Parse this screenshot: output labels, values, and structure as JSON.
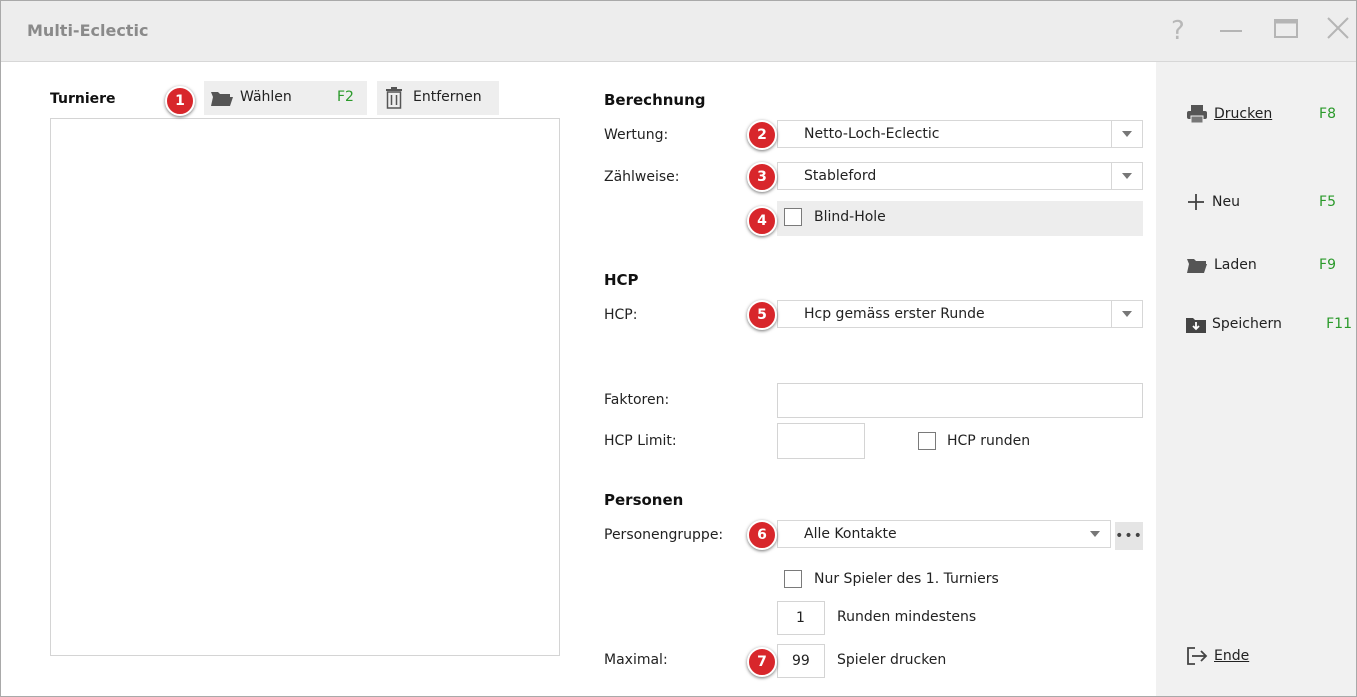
{
  "window": {
    "title": "Multi-Eclectic",
    "controls": [
      "help-icon",
      "minimize-icon",
      "maximize-icon",
      "close-icon"
    ]
  },
  "turniere": {
    "label": "Turniere",
    "waehlen_label": "Wählen",
    "waehlen_key": "F2",
    "entfernen_label": "Entfernen",
    "list_items": []
  },
  "berechnung": {
    "heading": "Berechnung",
    "wertung_label": "Wertung:",
    "wertung_value": "Netto-Loch-Eclectic",
    "zaehlweise_label": "Zählweise:",
    "zaehlweise_value": "Stableford",
    "blind_hole_label": "Blind-Hole",
    "blind_hole_checked": false
  },
  "hcp": {
    "heading": "HCP",
    "hcp_label": "HCP:",
    "hcp_value": "Hcp gemäss erster Runde",
    "faktoren_label": "Faktoren:",
    "faktoren_value": "",
    "limit_label": "HCP Limit:",
    "limit_value": "",
    "runden_label": "HCP runden",
    "runden_checked": false
  },
  "personen": {
    "heading": "Personen",
    "gruppe_label": "Personengruppe:",
    "gruppe_value": "Alle Kontakte",
    "more_label": "•••",
    "nur_spieler_label": "Nur Spieler des 1. Turniers",
    "nur_spieler_checked": false,
    "runden_min_value": "1",
    "runden_min_label": "Runden mindestens",
    "maximal_label": "Maximal:",
    "maximal_value": "99",
    "spieler_drucken_label": "Spieler drucken"
  },
  "sidebar": {
    "items": [
      {
        "label": "Drucken",
        "key": "F8",
        "icon": "printer-icon"
      },
      {
        "label": "Neu",
        "key": "F5",
        "icon": "plus-icon"
      },
      {
        "label": "Laden",
        "key": "F9",
        "icon": "folder-icon"
      },
      {
        "label": "Speichern",
        "key": "F11",
        "icon": "save-icon"
      },
      {
        "label": "Ende",
        "key": "",
        "icon": "exit-icon"
      }
    ]
  },
  "badges": [
    "1",
    "2",
    "3",
    "4",
    "5",
    "6",
    "7"
  ],
  "colors": {
    "badge": "#d8262b",
    "shortcut_key": "#2b9a2b",
    "sidebar_bg": "#f1f1f1",
    "titlebar_bg": "#ededed"
  }
}
